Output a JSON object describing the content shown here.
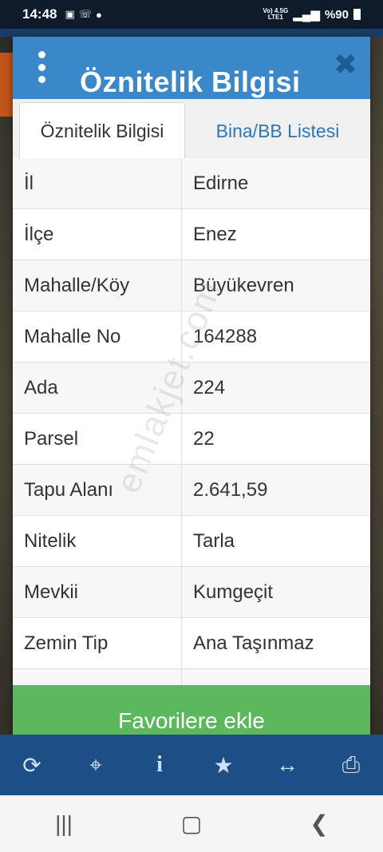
{
  "status_bar": {
    "time": "14:48",
    "network_top": "Vo) 4.5G",
    "network_bottom": "LTE1",
    "battery": "%90"
  },
  "dialog": {
    "title": "Öznitelik Bilgisi",
    "tabs": [
      {
        "label": "Öznitelik Bilgisi",
        "active": true
      },
      {
        "label": "Bina/BB Listesi",
        "active": false
      }
    ],
    "rows": [
      {
        "key": "İl",
        "value": "Edirne"
      },
      {
        "key": "İlçe",
        "value": "Enez"
      },
      {
        "key": "Mahalle/Köy",
        "value": "Büyükevren"
      },
      {
        "key": "Mahalle No",
        "value": "164288"
      },
      {
        "key": "Ada",
        "value": "224"
      },
      {
        "key": "Parsel",
        "value": "22"
      },
      {
        "key": "Tapu Alanı",
        "value": "2.641,59"
      },
      {
        "key": "Nitelik",
        "value": "Tarla"
      },
      {
        "key": "Mevkii",
        "value": "Kumgeçit"
      },
      {
        "key": "Zemin Tip",
        "value": "Ana Taşınmaz"
      }
    ],
    "favorite_button": "Favorilere ekle",
    "watermark": "emlakjet.com"
  },
  "toolbar": {
    "icons": [
      "refresh-icon",
      "crosshair-icon",
      "info-icon",
      "star-icon",
      "measure-icon",
      "print-icon"
    ]
  },
  "colors": {
    "header_blue": "#3a87c9",
    "tab_text_blue": "#2f76b5",
    "button_green": "#5cb85c",
    "toolbar_blue": "#1d4f86"
  }
}
